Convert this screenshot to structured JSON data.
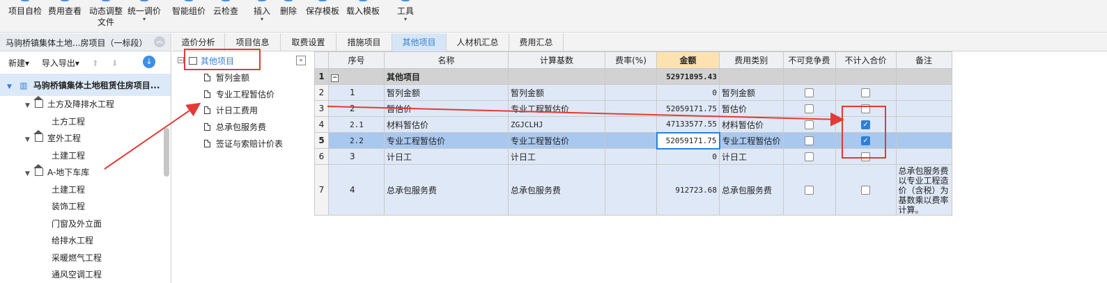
{
  "toolbar": {
    "items": [
      {
        "label": "项目自检",
        "label2": ""
      },
      {
        "label": "费用查看",
        "label2": ""
      },
      {
        "label": "动态调整",
        "label2": "文件"
      },
      {
        "label": "统一调价",
        "label2": "▾"
      },
      {
        "label": "智能组价",
        "label2": ""
      },
      {
        "label": "云检查",
        "label2": ""
      },
      {
        "label": "插入",
        "label2": "▾"
      },
      {
        "label": "删除",
        "label2": ""
      },
      {
        "label": "保存模板",
        "label2": ""
      },
      {
        "label": "载入模板",
        "label2": ""
      },
      {
        "label": "工具",
        "label2": "▾"
      }
    ]
  },
  "project": {
    "header": "马驹桥镇集体土地...房项目（一标段）",
    "new_label": "新建▾",
    "import_export_label": "导入导出▾",
    "root": "马驹桥镇集体土地租赁住房项目...",
    "nodes": [
      {
        "label": "土方及降排水工程",
        "level": 1
      },
      {
        "label": "土方工程",
        "level": 2
      },
      {
        "label": "室外工程",
        "level": 1
      },
      {
        "label": "土建工程",
        "level": 2
      },
      {
        "label": "A-地下车库",
        "level": 1
      },
      {
        "label": "土建工程",
        "level": 2
      },
      {
        "label": "装饰工程",
        "level": 2
      },
      {
        "label": "门窗及外立面",
        "level": 2
      },
      {
        "label": "给排水工程",
        "level": 2
      },
      {
        "label": "采暖燃气工程",
        "level": 2
      },
      {
        "label": "通风空调工程",
        "level": 2
      }
    ]
  },
  "tabs": [
    "造价分析",
    "项目信息",
    "取费设置",
    "措施项目",
    "其他项目",
    "人材机汇总",
    "费用汇总"
  ],
  "active_tab": "其他项目",
  "mid_tree": {
    "root": "其他项目",
    "items": [
      "暂列金额",
      "专业工程暂估价",
      "计日工费用",
      "总承包服务费",
      "签证与索赔计价表"
    ]
  },
  "grid": {
    "headers": [
      "序号",
      "名称",
      "计算基数",
      "费率(%)",
      "金额",
      "费用类别",
      "不可竞争费",
      "不计入合价",
      "备注"
    ],
    "rows": [
      {
        "row": "1",
        "seq": "",
        "name": "其他项目",
        "base": "",
        "rate": "",
        "amount": "52971895.43",
        "category": "",
        "noncompete": "",
        "exclude": "",
        "note": ""
      },
      {
        "row": "2",
        "seq": "1",
        "name": "暂列金额",
        "base": "暂列金额",
        "rate": "",
        "amount": "0",
        "category": "暂列金额",
        "noncompete": false,
        "exclude": false,
        "note": ""
      },
      {
        "row": "3",
        "seq": "2",
        "name": "暂估价",
        "base": "专业工程暂估价",
        "rate": "",
        "amount": "52059171.75",
        "category": "暂估价",
        "noncompete": false,
        "exclude": false,
        "note": ""
      },
      {
        "row": "4",
        "seq": "2.1",
        "name": "材料暂估价",
        "base": "ZGJCLHJ",
        "rate": "",
        "amount": "47133577.55",
        "category": "材料暂估价",
        "noncompete": false,
        "exclude": true,
        "note": ""
      },
      {
        "row": "5",
        "seq": "2.2",
        "name": "专业工程暂估价",
        "base": "专业工程暂估价",
        "rate": "",
        "amount": "52059171.75",
        "category": "专业工程暂估价",
        "noncompete": false,
        "exclude": true,
        "note": ""
      },
      {
        "row": "6",
        "seq": "3",
        "name": "计日工",
        "base": "计日工",
        "rate": "",
        "amount": "0",
        "category": "计日工",
        "noncompete": false,
        "exclude": false,
        "note": ""
      },
      {
        "row": "7",
        "seq": "4",
        "name": "总承包服务费",
        "base": "总承包服务费",
        "rate": "",
        "amount": "912723.68",
        "category": "总承包服务费",
        "noncompete": false,
        "exclude": false,
        "note": "总承包服务费以专业工程造价（含税）为基数乘以费率计算。"
      }
    ]
  },
  "colors": {
    "accent": "#3a7fd0",
    "annotation": "#e53935",
    "amount_header": "#fde2b1"
  }
}
